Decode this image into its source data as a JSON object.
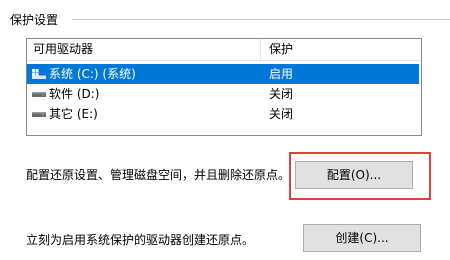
{
  "group": {
    "title": "保护设置"
  },
  "drives_table": {
    "columns": [
      "可用驱动器",
      "保护"
    ],
    "rows": [
      {
        "name": "系统 (C:) (系统)",
        "protection": "启用",
        "icon": "system-drive-icon",
        "selected": true
      },
      {
        "name": "软件 (D:)",
        "protection": "关闭",
        "icon": "drive-icon",
        "selected": false
      },
      {
        "name": "其它 (E:)",
        "protection": "关闭",
        "icon": "drive-icon",
        "selected": false
      }
    ]
  },
  "configure": {
    "description": "配置还原设置、管理磁盘空间，并且删除还原点。",
    "button_label": "配置(O)..."
  },
  "create": {
    "description": "立刻为启用系统保护的驱动器创建还原点。",
    "button_label": "创建(C)..."
  },
  "colors": {
    "selection": "#0078d7",
    "highlight_box": "#e0403a",
    "button_face": "#e1e1e1"
  }
}
